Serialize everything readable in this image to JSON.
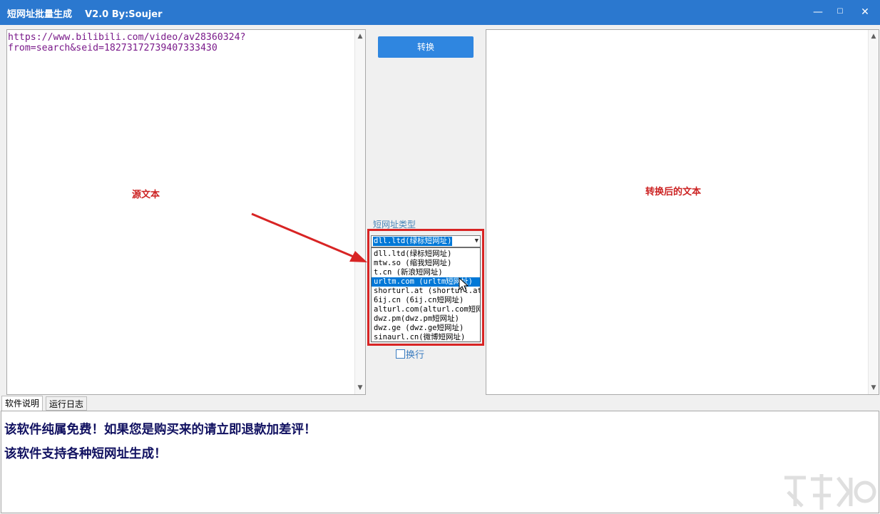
{
  "window": {
    "title": "短网址批量生成    V2.0 By:Soujer",
    "minimize_glyph": "—",
    "maximize_glyph": "☐",
    "close_glyph": "✕"
  },
  "source_panel": {
    "text_line1": "https://www.bilibili.com/video/av28360324?",
    "text_line2": "from=search&seid=18273172739407333430",
    "overlay_label": "源文本"
  },
  "result_panel": {
    "overlay_label": "转换后的文本"
  },
  "controls": {
    "convert_label": "转换",
    "type_label": "短网址类型",
    "selected_value": "dll.ltd(绿标短网址)",
    "options": [
      "dll.ltd(绿标短网址)",
      "mtw.so (缩我短网址)",
      "t.cn (新浪短网址)",
      "urltm.com (urltm短网址)",
      "shorturl.at (shorturl.at短网址)",
      "6ij.cn (6ij.cn短网址)",
      "alturl.com(alturl.com短网址)",
      "dwz.pm(dwz.pm短网址)",
      "dwz.ge (dwz.ge短网址)",
      "sinaurl.cn(微博短网址)"
    ],
    "highlighted_option_index": 3,
    "wrap_label": "换行"
  },
  "tabs": [
    {
      "label": "软件说明",
      "active": true
    },
    {
      "label": "运行日志",
      "active": false
    }
  ],
  "notice": {
    "line1": "该软件纯属免费！如果您是购买来的请立即退款加差评！",
    "line2": "该软件支持各种短网址生成！"
  },
  "colors": {
    "titlebar": "#2b78cf",
    "accent_button": "#2f86e0",
    "annotation_red": "#d82424",
    "selection_blue": "#0078d7"
  }
}
